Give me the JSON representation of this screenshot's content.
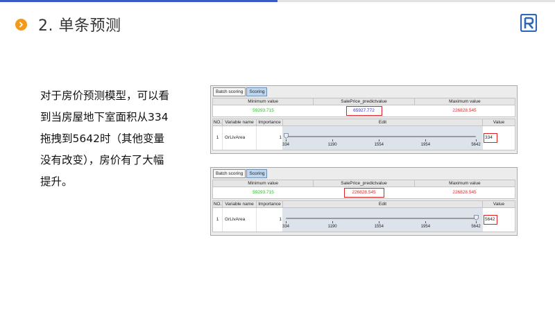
{
  "header": {
    "title": "2. 单条预测"
  },
  "description": {
    "lines": [
      "对于房价预测模型，可以看",
      "到当房屋地下室面积从334",
      "拖拽到5642时（其他变量",
      "没有改变），房价有了大幅",
      "提升。"
    ]
  },
  "colors": {
    "accent_blue": "#3a5bc7",
    "accent_orange": "#f39a1a",
    "highlight_red": "#e02020",
    "min_green": "#2fb82f",
    "pred_blue": "#3333cc",
    "max_red": "#d42c2c"
  },
  "icons": {
    "bullet": "chevron-right-icon",
    "logo": "brand-logo"
  },
  "panels": [
    {
      "tabs": [
        "Batch scoring",
        "Scoring"
      ],
      "active_tab": "Scoring",
      "headers": [
        "Minimum value",
        "SalePrice_predictvalue",
        "Maximum value"
      ],
      "min_value": "59293.715",
      "predict_value": "65927.772",
      "max_value": "226828.545",
      "grid_headers": [
        "NO.",
        "Variable name",
        "Importance",
        "Edit",
        "Value"
      ],
      "row": {
        "no": "1",
        "variable": "GrLivArea",
        "importance": "1",
        "ticks": [
          "334",
          "1190",
          "1554",
          "1954",
          "5642"
        ],
        "value": "334",
        "slider_position": 0.0
      }
    },
    {
      "tabs": [
        "Batch scoring",
        "Scoring"
      ],
      "active_tab": "Scoring",
      "headers": [
        "Minimum value",
        "SalePrice_predictvalue",
        "Maximum value"
      ],
      "min_value": "59293.715",
      "predict_value": "226828.545",
      "max_value": "226828.545",
      "grid_headers": [
        "NO.",
        "Variable name",
        "Importance",
        "Edit",
        "Value"
      ],
      "row": {
        "no": "1",
        "variable": "GrLivArea",
        "importance": "1",
        "ticks": [
          "334",
          "1190",
          "1554",
          "1954",
          "5642"
        ],
        "value": "5642",
        "slider_position": 1.0
      }
    }
  ]
}
